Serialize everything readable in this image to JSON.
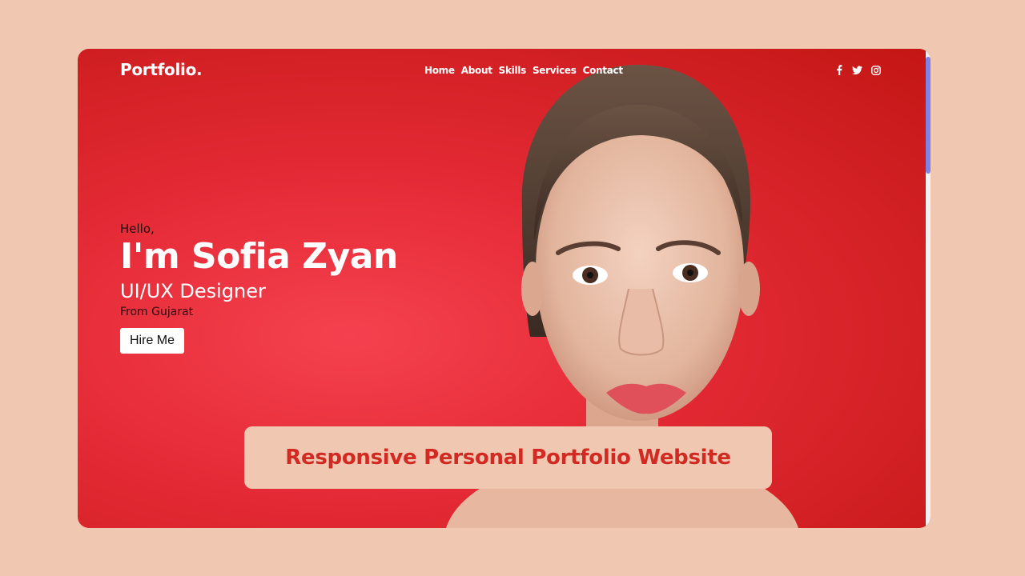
{
  "header": {
    "logo": "Portfolio.",
    "nav": [
      "Home",
      "About",
      "Skills",
      "Services",
      "Contact"
    ],
    "social_icons": [
      "facebook-icon",
      "twitter-icon",
      "instagram-icon"
    ]
  },
  "hero": {
    "greeting": "Hello,",
    "name": "I'm Sofia Zyan",
    "role": "UI/UX Designer",
    "location": "From Gujarat",
    "cta_label": "Hire Me"
  },
  "banner": {
    "text": "Responsive Personal Portfolio Website"
  },
  "colors": {
    "page_background": "#f0c8b2",
    "hero_red": "#e42a35",
    "banner_text": "#d22a22",
    "scrollbar_thumb": "#7e82e6"
  }
}
